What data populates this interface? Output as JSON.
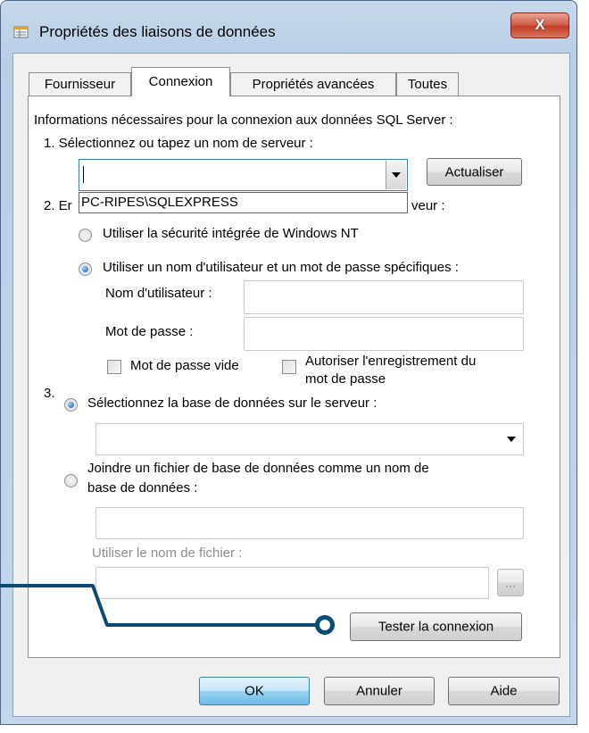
{
  "window": {
    "title": "Propriétés des liaisons de données",
    "close_label": "X"
  },
  "tabs": [
    {
      "label": "Fournisseur",
      "active": false
    },
    {
      "label": "Connexion",
      "active": true
    },
    {
      "label": "Propriétés avancées",
      "active": false
    },
    {
      "label": "Toutes",
      "active": false
    }
  ],
  "connection": {
    "intro": "Informations nécessaires pour la connexion aux données SQL Server :",
    "step1_label": "1. Sélectionnez ou tapez un nom de serveur :",
    "server_value": "",
    "server_dropdown_option": "PC-RIPES\\SQLEXPRESS",
    "refresh_button": "Actualiser",
    "step2_label_start": "2. Er",
    "step2_label_end": "veur :",
    "radio_windows_nt": "Utiliser la sécurité intégrée de Windows NT",
    "radio_user_password": "Utiliser un nom d'utilisateur et un mot de passe spécifiques :",
    "username_label": "Nom d'utilisateur :",
    "username_value": "",
    "password_label": "Mot de passe :",
    "password_value": "",
    "blank_password_checkbox": "Mot de passe vide",
    "allow_saving_checkbox_line1": "Autoriser l'enregistrement du",
    "allow_saving_checkbox_line2": "mot de passe",
    "step3_label": "3.",
    "radio_select_db": "Sélectionnez la base de données sur le serveur :",
    "database_value": "",
    "radio_attach_file_line1": "Joindre un fichier de base de données comme un nom de",
    "radio_attach_file_line2": "base de données :",
    "attach_name_value": "",
    "filename_label": "Utiliser le nom de fichier :",
    "filename_value": "",
    "browse_button": "...",
    "test_button": "Tester la connexion"
  },
  "footer": {
    "ok_button": "OK",
    "cancel_button": "Annuler",
    "help_button": "Aide"
  },
  "colors": {
    "callout": "#0b4a72",
    "default_button_border": "#3c7fb1"
  }
}
